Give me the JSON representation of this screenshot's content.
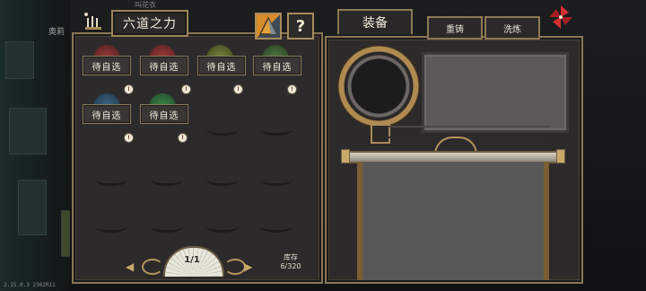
{
  "background": {
    "player_name_left": "奥莉",
    "player_name_top": "叫花衣",
    "version": "2.15.0.3 2302R11"
  },
  "left_panel": {
    "title": "六道之力",
    "help_label": "?",
    "slots": [
      {
        "label": "待自选",
        "gem_color": "#7a2828",
        "badge": "!"
      },
      {
        "label": "待自选",
        "gem_color": "#8a2a2a",
        "badge": "!"
      },
      {
        "label": "待自选",
        "gem_color": "#5f6a2a",
        "badge": "!"
      },
      {
        "label": "待自选",
        "gem_color": "#3e5d34",
        "badge": "!"
      },
      {
        "label": "待自选",
        "gem_color": "#2f4d6a",
        "badge": "!"
      },
      {
        "label": "待自选",
        "gem_color": "#2f6a3a",
        "badge": "!"
      }
    ],
    "pager": {
      "current": "1/1"
    },
    "stock": {
      "label": "库存",
      "value": "6/320"
    }
  },
  "right_panel": {
    "tabs": [
      {
        "label": "装备",
        "active": true
      },
      {
        "label": "重铸",
        "active": false
      },
      {
        "label": "洗炼",
        "active": false
      }
    ]
  },
  "colors": {
    "frame_gold": "#8a7655",
    "panel_bg": "#2d2a2b",
    "text": "#f3ecdd",
    "pinwheel_red": "#c7282d"
  }
}
